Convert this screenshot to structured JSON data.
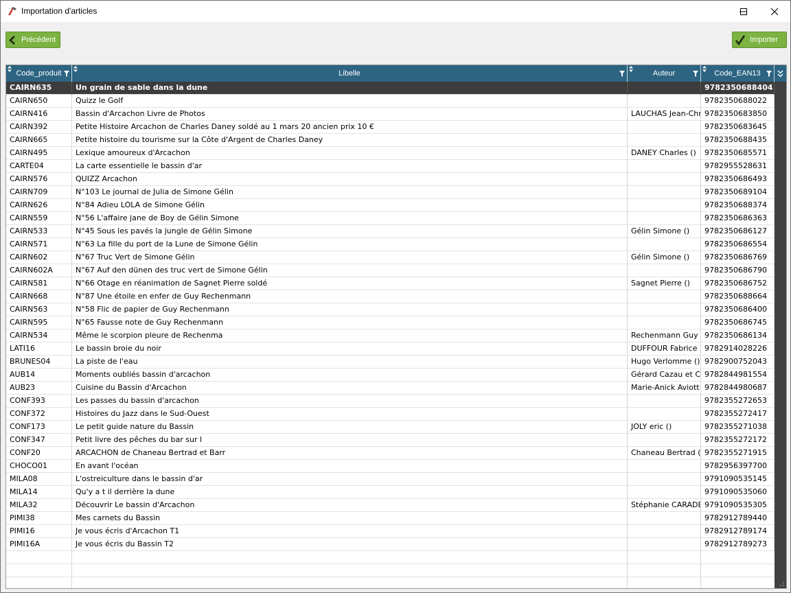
{
  "window": {
    "title": "Importation d'articles"
  },
  "toolbar": {
    "prev_label": "Précédent",
    "import_label": "Importer"
  },
  "columns": [
    "Code_produit",
    "Libelle",
    "Auteur",
    "Code_EAN13"
  ],
  "rows": [
    [
      "CAIRN635",
      "Un grain de sable dans la dune",
      "",
      "9782350688404"
    ],
    [
      "CAIRN650",
      "Quizz le Golf",
      "",
      "9782350688022"
    ],
    [
      "CAIRN416",
      "Bassin d'Arcachon Livre de Photos",
      "LAUCHAS Jean-Chr",
      "9782350683850"
    ],
    [
      "CAIRN392",
      "Petite Histoire Arcachon de Charles Daney soldé au 1 mars 20 ancien prix 10 €",
      "",
      "9782350683645"
    ],
    [
      "CAIRN665",
      "Petite histoire du tourisme sur la Côte d'Argent de Charles Daney",
      "",
      "9782350688435"
    ],
    [
      "CAIRN495",
      "Lexique amoureux d'Arcachon",
      "DANEY Charles  ()",
      "9782350685571"
    ],
    [
      "CARTE04",
      "La carte essentielle le bassin d'ar",
      "",
      "9782955528631"
    ],
    [
      "CAIRN576",
      "QUIZZ Arcachon",
      "",
      "9782350686493"
    ],
    [
      "CAIRN709",
      "N°103  Le journal de Julia de Simone Gélin",
      "",
      "9782350689104"
    ],
    [
      "CAIRN626",
      "N°84 Adieu LOLA de Simone Gélin",
      "",
      "9782350688374"
    ],
    [
      "CAIRN559",
      "N°56 L'affaire jane de Boy de Gélin Simone",
      "",
      "9782350686363"
    ],
    [
      "CAIRN533",
      "N°45 Sous les pavés la jungle de Gélin Simone",
      "Gélin Simone ()",
      "9782350686127"
    ],
    [
      "CAIRN571",
      "N°63 La fille du port de la Lune de Simone Gélin",
      "",
      "9782350686554"
    ],
    [
      "CAIRN602",
      "N°67 Truc Vert de Simone Gélin",
      "Gélin Simone  ()",
      "9782350686769"
    ],
    [
      "CAIRN602A",
      "N°67 Auf den dünen des truc vert de Simone Gélin",
      "",
      "9782350686790"
    ],
    [
      "CAIRN581",
      "N°66 Otage en réanimation de Sagnet Pierre soldé",
      "Sagnet Pierre ()",
      "9782350686752"
    ],
    [
      "CAIRN668",
      "N°87 Une étoile en enfer de Guy Rechenmann",
      "",
      "9782350688664"
    ],
    [
      "CAIRN563",
      "N°58 Flic de papier de Guy Rechenmann",
      "",
      "9782350686400"
    ],
    [
      "CAIRN595",
      "N°65 Fausse note de Guy Rechenmann",
      "",
      "9782350686745"
    ],
    [
      "CAIRN534",
      "Même le scorpion pleure de Rechenma",
      "Rechenmann Guy",
      "9782350686134"
    ],
    [
      "LATI16",
      "Le bassin broie du noir",
      "DUFFOUR Fabrice",
      "9782914028226"
    ],
    [
      "BRUNES04",
      "La piste de l'eau",
      "Hugo Verlomme ()",
      "9782900752043"
    ],
    [
      "AUB14",
      "Moments oubliés bassin d'arcachon",
      "Gérard Cazau et C",
      "9782844981554"
    ],
    [
      "AUB23",
      "Cuisine du Bassin d'Arcachon",
      "Marie-Anick Aviott",
      "9782844980687"
    ],
    [
      "CONF393",
      "Les passes du bassin d'arcachon",
      "",
      "9782355272653"
    ],
    [
      "CONF372",
      "Histoires du Jazz dans le Sud-Ouest",
      "",
      "9782355272417"
    ],
    [
      "CONF173",
      "Le petit guide nature du Bassin",
      "JOLY eric ()",
      "9782355271038"
    ],
    [
      "CONF347",
      "Petit livre des pêches du bar sur l",
      "",
      "9782355272172"
    ],
    [
      "CONF20",
      "ARCACHON de Chaneau Bertrad et Barr",
      "Chaneau Bertrad (",
      "9782355271915"
    ],
    [
      "CHOCO01",
      "En avant l'océan",
      "",
      "9782956397700"
    ],
    [
      "MILA08",
      "L'ostreiculture dans le bassin d'ar",
      "",
      "9791090535145"
    ],
    [
      "MILA14",
      "Qu'y a t il derrière la dune",
      "",
      "9791090535060"
    ],
    [
      "MILA32",
      "Découvrir Le bassin d'Arcachon",
      "Stéphanie CARADE",
      "9791090535305"
    ],
    [
      "PIMI38",
      "Mes carnets du Bassin",
      "",
      "9782912789440"
    ],
    [
      "PIMI16",
      "Je vous écris d'Arcachon T1",
      "",
      "9782912789174"
    ],
    [
      "PIMI16A",
      "Je vous écris du Bassin T2",
      "",
      "9782912789273"
    ]
  ],
  "empty_rows": 3,
  "selected_index": 0,
  "colors": {
    "header_bg": "#2c6482",
    "button_green": "#7cb342",
    "selected_row": "#3c3c3c",
    "scrollbar": "#404040"
  }
}
